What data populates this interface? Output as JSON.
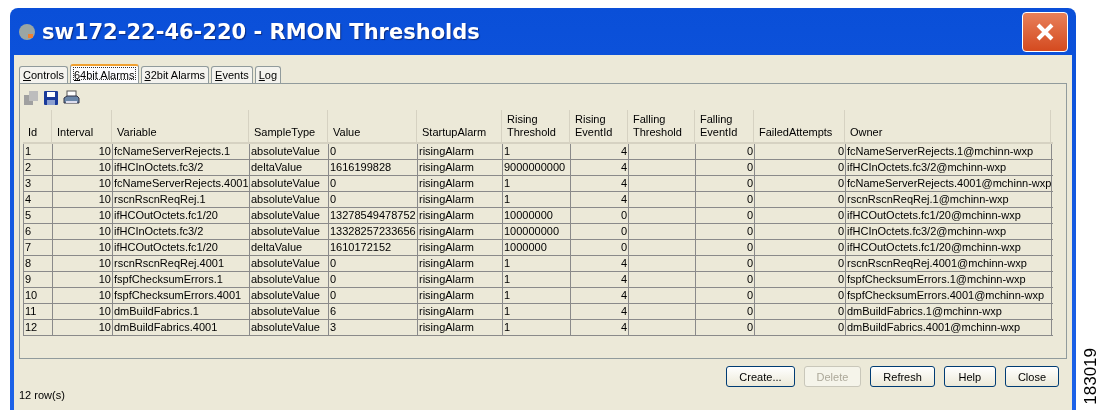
{
  "window": {
    "title": "sw172-22-46-220 - RMON Thresholds"
  },
  "tabs": [
    {
      "label": "Controls",
      "selected": false
    },
    {
      "label": "64bit Alarms",
      "selected": true
    },
    {
      "label": "32bit Alarms",
      "selected": false
    },
    {
      "label": "Events",
      "selected": false
    },
    {
      "label": "Log",
      "selected": false
    }
  ],
  "table": {
    "columns": [
      "Id",
      "Interval",
      "Variable",
      "SampleType",
      "Value",
      "StartupAlarm",
      "Rising Threshold",
      "Rising EventId",
      "Falling Threshold",
      "Falling EventId",
      "FailedAttempts",
      "Owner"
    ],
    "rows": [
      {
        "id": "1",
        "interval": "10",
        "variable": "fcNameServerRejects.1",
        "sample_type": "absoluteValue",
        "value": "0",
        "startup_alarm": "risingAlarm",
        "rising_threshold": "1",
        "rising_event_id": "4",
        "falling_event_id": "0",
        "failed_attempts": "0",
        "owner": "fcNameServerRejects.1@mchinn-wxp"
      },
      {
        "id": "2",
        "interval": "10",
        "variable": "ifHCInOctets.fc3/2",
        "sample_type": "deltaValue",
        "value": "1616199828",
        "startup_alarm": "risingAlarm",
        "rising_threshold": "9000000000",
        "rising_event_id": "4",
        "falling_event_id": "0",
        "failed_attempts": "0",
        "owner": "ifHCInOctets.fc3/2@mchinn-wxp"
      },
      {
        "id": "3",
        "interval": "10",
        "variable": "fcNameServerRejects.4001",
        "sample_type": "absoluteValue",
        "value": "0",
        "startup_alarm": "risingAlarm",
        "rising_threshold": "1",
        "rising_event_id": "4",
        "falling_event_id": "0",
        "failed_attempts": "0",
        "owner": "fcNameServerRejects.4001@mchinn-wxp"
      },
      {
        "id": "4",
        "interval": "10",
        "variable": "rscnRscnReqRej.1",
        "sample_type": "absoluteValue",
        "value": "0",
        "startup_alarm": "risingAlarm",
        "rising_threshold": "1",
        "rising_event_id": "4",
        "falling_event_id": "0",
        "failed_attempts": "0",
        "owner": "rscnRscnReqRej.1@mchinn-wxp"
      },
      {
        "id": "5",
        "interval": "10",
        "variable": "ifHCOutOctets.fc1/20",
        "sample_type": "absoluteValue",
        "value": "13278549478752",
        "startup_alarm": "risingAlarm",
        "rising_threshold": "10000000",
        "rising_event_id": "0",
        "falling_event_id": "0",
        "failed_attempts": "0",
        "owner": "ifHCOutOctets.fc1/20@mchinn-wxp"
      },
      {
        "id": "6",
        "interval": "10",
        "variable": "ifHCInOctets.fc3/2",
        "sample_type": "absoluteValue",
        "value": "13328257233656",
        "startup_alarm": "risingAlarm",
        "rising_threshold": "100000000",
        "rising_event_id": "0",
        "falling_event_id": "0",
        "failed_attempts": "0",
        "owner": "ifHCInOctets.fc3/2@mchinn-wxp"
      },
      {
        "id": "7",
        "interval": "10",
        "variable": "ifHCOutOctets.fc1/20",
        "sample_type": "deltaValue",
        "value": "1610172152",
        "startup_alarm": "risingAlarm",
        "rising_threshold": "1000000",
        "rising_event_id": "0",
        "falling_event_id": "0",
        "failed_attempts": "0",
        "owner": "ifHCOutOctets.fc1/20@mchinn-wxp"
      },
      {
        "id": "8",
        "interval": "10",
        "variable": "rscnRscnReqRej.4001",
        "sample_type": "absoluteValue",
        "value": "0",
        "startup_alarm": "risingAlarm",
        "rising_threshold": "1",
        "rising_event_id": "4",
        "falling_event_id": "0",
        "failed_attempts": "0",
        "owner": "rscnRscnReqRej.4001@mchinn-wxp"
      },
      {
        "id": "9",
        "interval": "10",
        "variable": "fspfChecksumErrors.1",
        "sample_type": "absoluteValue",
        "value": "0",
        "startup_alarm": "risingAlarm",
        "rising_threshold": "1",
        "rising_event_id": "4",
        "falling_event_id": "0",
        "failed_attempts": "0",
        "owner": "fspfChecksumErrors.1@mchinn-wxp"
      },
      {
        "id": "10",
        "interval": "10",
        "variable": "fspfChecksumErrors.4001",
        "sample_type": "absoluteValue",
        "value": "0",
        "startup_alarm": "risingAlarm",
        "rising_threshold": "1",
        "rising_event_id": "4",
        "falling_event_id": "0",
        "failed_attempts": "0",
        "owner": "fspfChecksumErrors.4001@mchinn-wxp"
      },
      {
        "id": "11",
        "interval": "10",
        "variable": "dmBuildFabrics.1",
        "sample_type": "absoluteValue",
        "value": "6",
        "startup_alarm": "risingAlarm",
        "rising_threshold": "1",
        "rising_event_id": "4",
        "falling_event_id": "0",
        "failed_attempts": "0",
        "owner": "dmBuildFabrics.1@mchinn-wxp"
      },
      {
        "id": "12",
        "interval": "10",
        "variable": "dmBuildFabrics.4001",
        "sample_type": "absoluteValue",
        "value": "3",
        "startup_alarm": "risingAlarm",
        "rising_threshold": "1",
        "rising_event_id": "4",
        "falling_event_id": "0",
        "failed_attempts": "0",
        "owner": "dmBuildFabrics.4001@mchinn-wxp"
      }
    ]
  },
  "buttons": [
    {
      "label": "Create...",
      "disabled": false
    },
    {
      "label": "Delete",
      "disabled": true
    },
    {
      "label": "Refresh",
      "disabled": false
    },
    {
      "label": "Help",
      "disabled": false
    },
    {
      "label": "Close",
      "disabled": false
    }
  ],
  "status_bar": {
    "text": "12 row(s)"
  },
  "figure_number": "183019"
}
